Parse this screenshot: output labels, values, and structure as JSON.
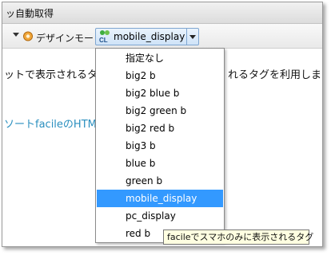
{
  "header": {
    "title": "ッ自動取得"
  },
  "toolbar": {
    "design_mode_label": "デザインモード",
    "select": {
      "icon_text": "CL",
      "value": "mobile_display"
    }
  },
  "content": {
    "line1_left": "ットで表示されるタグ",
    "line1_right": "れるタグを利用します",
    "link_text": "ソートfacileのHTML"
  },
  "dropdown": {
    "options": [
      "指定なし",
      "big2 b",
      "big2 blue b",
      "big2 green b",
      "big2 red b",
      "big3 b",
      "blue b",
      "green b",
      "mobile_display",
      "pc_display",
      "red b"
    ],
    "selected_index": 8
  },
  "tooltip": {
    "text": "facileでスマホのみに表示されるタグ"
  },
  "colors": {
    "selection": "#3399ff",
    "link": "#2a8fbf",
    "tooltip_bg": "#ffffe1"
  },
  "icons": [
    "chevron-down-icon",
    "design-mode-icon",
    "cl-style-icon"
  ]
}
